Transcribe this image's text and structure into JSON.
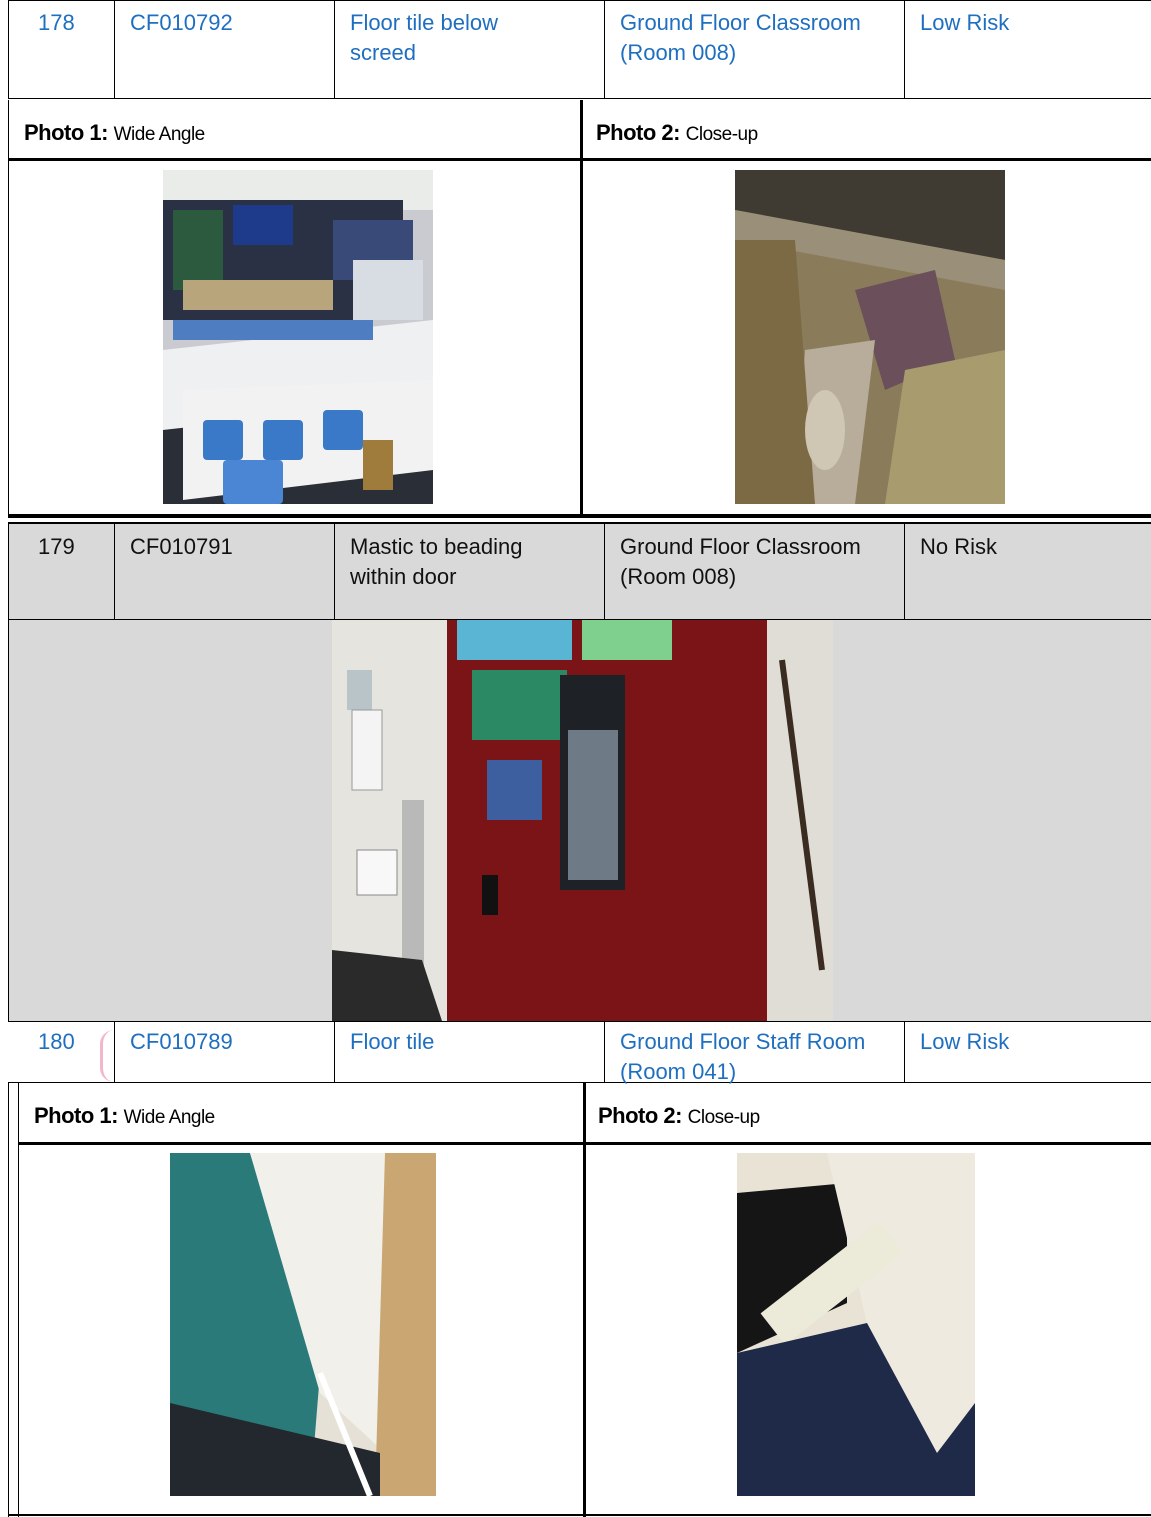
{
  "rows": [
    {
      "num": "178",
      "code": "CF010792",
      "material": "Floor tile below screed",
      "location": "Ground Floor Classroom (Room 008)",
      "risk": "Low Risk"
    },
    {
      "num": "179",
      "code": "CF010791",
      "material": "Mastic to beading within door",
      "location": "Ground Floor Classroom (Room 008)",
      "risk": "No Risk"
    },
    {
      "num": "180",
      "code": "CF010789",
      "material": "Floor tile",
      "location": "Ground Floor Staff Room (Room 041)",
      "risk": "Low Risk"
    }
  ],
  "photo_labels": {
    "photo1_bold": "Photo 1:",
    "photo1_text": "Wide Angle",
    "photo2_bold": "Photo 2:",
    "photo2_text": "Close-up"
  },
  "colors": {
    "link_blue": "#1f6fc0",
    "row_grey": "#d9d9d9"
  }
}
